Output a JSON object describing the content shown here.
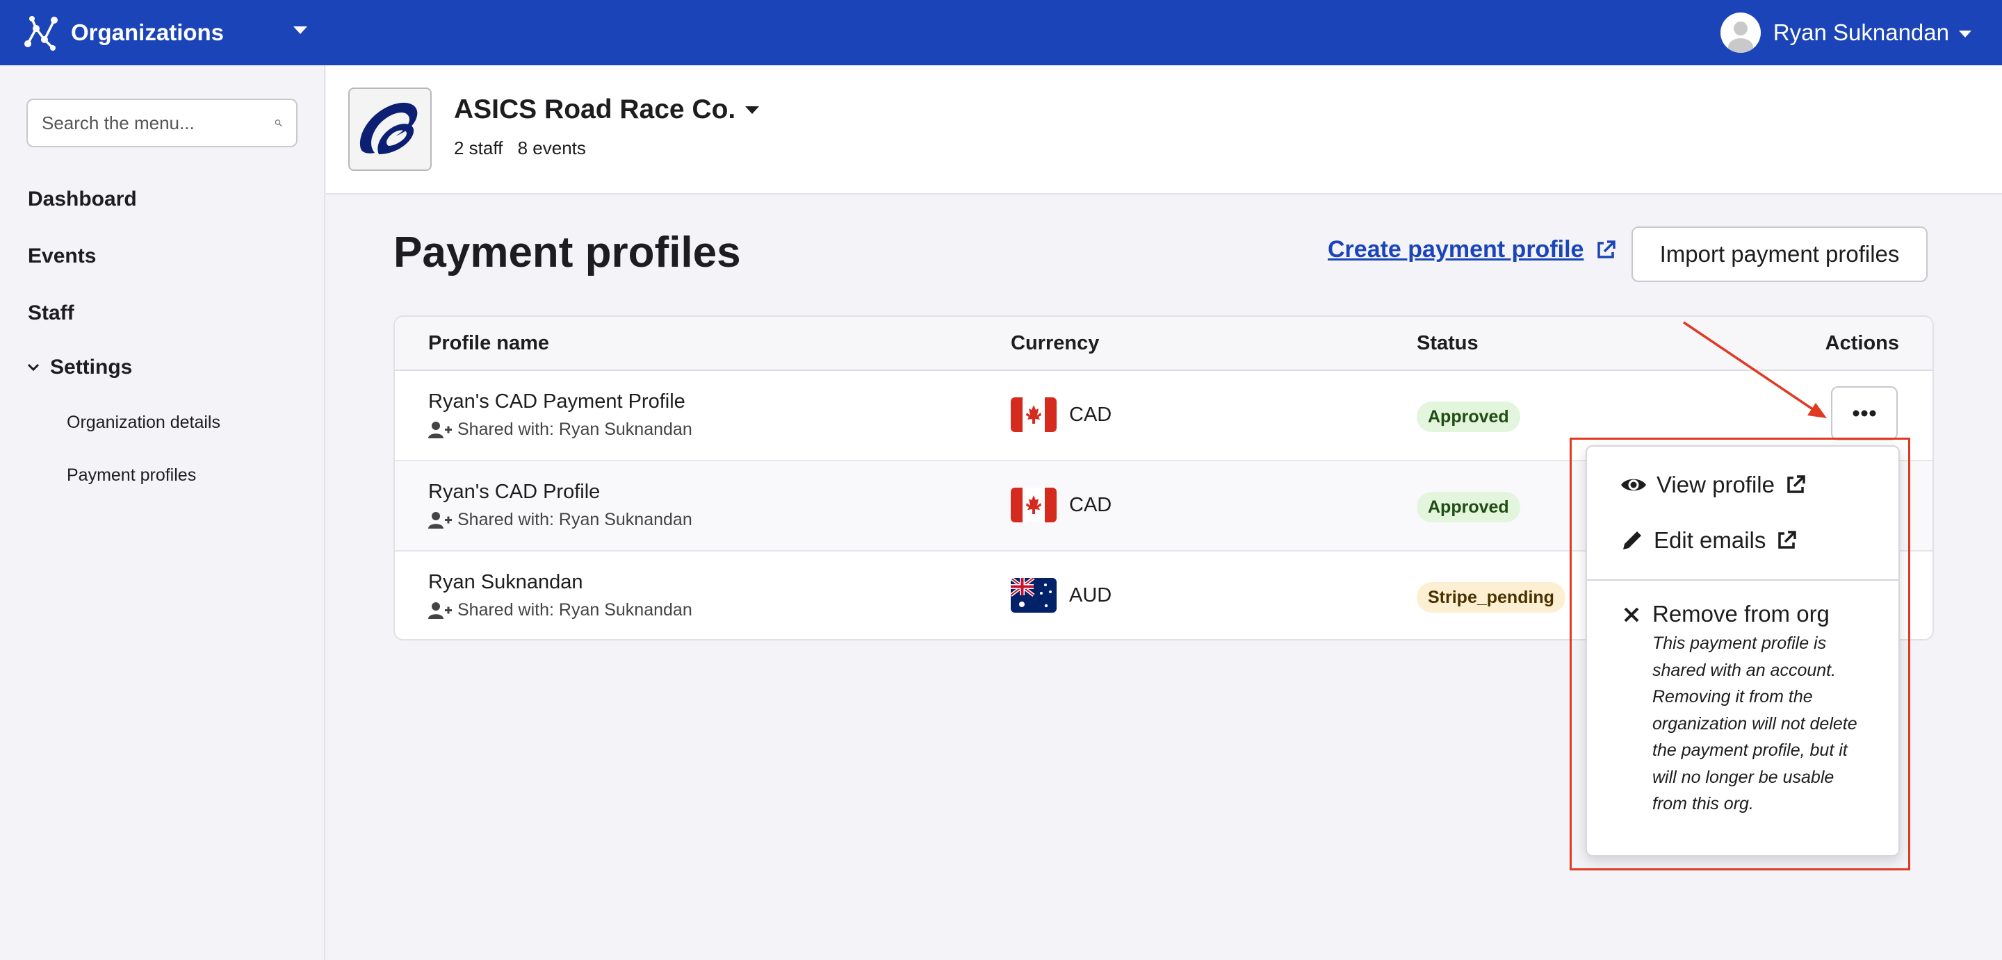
{
  "topbar": {
    "title": "Organizations",
    "user_name": "Ryan Suknandan",
    "icons": {
      "brand": "network-graph-icon",
      "avatar": "user-avatar-icon"
    }
  },
  "sidebar": {
    "search_placeholder": "Search the menu...",
    "items": [
      {
        "label": "Dashboard"
      },
      {
        "label": "Events"
      },
      {
        "label": "Staff"
      },
      {
        "label": "Settings",
        "expanded": true
      }
    ],
    "settings_items": [
      {
        "label": "Organization details"
      },
      {
        "label": "Payment profiles"
      }
    ]
  },
  "org": {
    "name": "ASICS Road Race Co.",
    "staff": "2 staff",
    "events": "8 events"
  },
  "page": {
    "title": "Payment profiles",
    "create_link": "Create payment profile",
    "import_button": "Import payment profiles"
  },
  "table": {
    "headers": {
      "name": "Profile name",
      "currency": "Currency",
      "status": "Status",
      "actions": "Actions"
    },
    "rows": [
      {
        "name": "Ryan's CAD Payment Profile",
        "shared": "Shared with: Ryan Suknandan",
        "currency": "CAD",
        "flag": "canada-flag-icon",
        "status": "Approved"
      },
      {
        "name": "Ryan's CAD Profile",
        "shared": "Shared with: Ryan Suknandan",
        "currency": "CAD",
        "flag": "canada-flag-icon",
        "status": "Approved"
      },
      {
        "name": "Ryan Suknandan",
        "shared": "Shared with: Ryan Suknandan",
        "currency": "AUD",
        "flag": "australia-flag-icon",
        "status": "Stripe_pending"
      }
    ]
  },
  "dropdown": {
    "view_profile": "View profile",
    "edit_emails": "Edit emails",
    "remove": "Remove from org",
    "remove_note_lines": [
      "This payment profile is",
      "shared with an account.",
      "Removing it from the",
      "organization will not delete",
      "the payment profile, but it",
      "will no longer be usable",
      "from this org."
    ]
  },
  "colors": {
    "topbar": "#1a44b8",
    "link": "#1a44b8",
    "approved_bg": "#e3f5dc",
    "pending_bg": "#fdf0d2",
    "highlight": "#e03a22"
  }
}
